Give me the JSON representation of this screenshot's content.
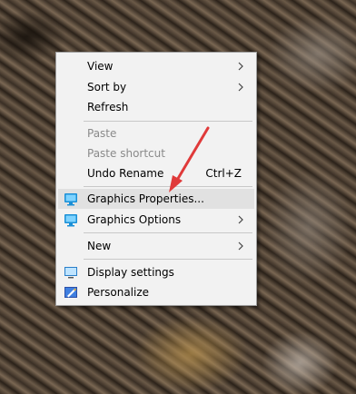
{
  "context_menu": {
    "items": [
      {
        "label": "View",
        "submenu": true
      },
      {
        "label": "Sort by",
        "submenu": true
      },
      {
        "label": "Refresh"
      },
      {
        "label": "Paste",
        "disabled": true
      },
      {
        "label": "Paste shortcut",
        "disabled": true
      },
      {
        "label": "Undo Rename",
        "shortcut": "Ctrl+Z"
      },
      {
        "label": "Graphics Properties...",
        "icon": "intel-graphics-icon",
        "highlighted": true
      },
      {
        "label": "Graphics Options",
        "icon": "intel-graphics-icon",
        "submenu": true
      },
      {
        "label": "New",
        "submenu": true
      },
      {
        "label": "Display settings",
        "icon": "display-icon"
      },
      {
        "label": "Personalize",
        "icon": "personalize-icon"
      }
    ]
  },
  "colors": {
    "arrow": "#e03a3a",
    "menu_bg": "#f2f2f2",
    "highlight": "#e1e1e1"
  }
}
